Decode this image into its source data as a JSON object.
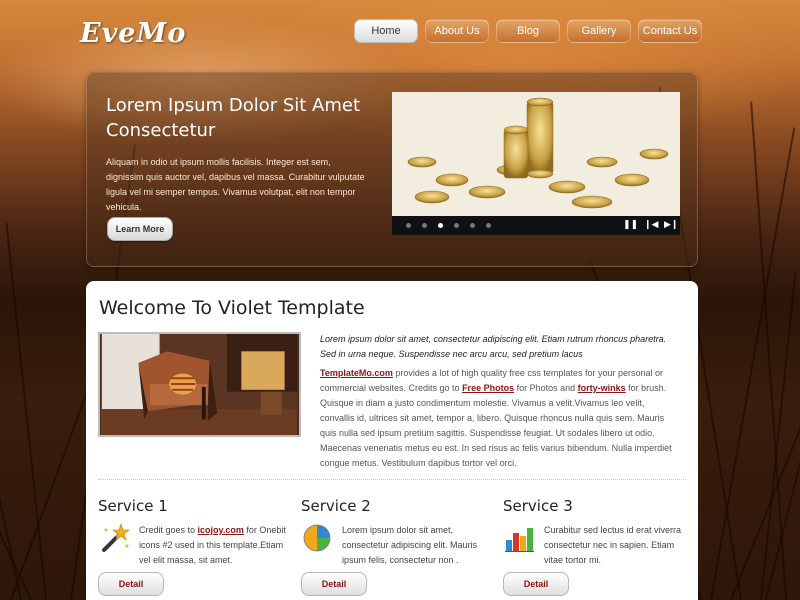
{
  "logo": "EveMo",
  "nav": [
    {
      "label": "Home",
      "active": true
    },
    {
      "label": "About Us",
      "active": false
    },
    {
      "label": "Blog",
      "active": false
    },
    {
      "label": "Gallery",
      "active": false
    },
    {
      "label": "Contact Us",
      "active": false
    }
  ],
  "banner": {
    "title": "Lorem Ipsum Dolor Sit Amet Consectetur",
    "text": "Aliquam in odio ut ipsum mollis facilisis. Integer est sem, dignissim quis auctor vel, dapibus vel massa. Curabitur vulputate ligula vel mi semper tempus. Vivamus volutpat, elit non tempor vehicula.",
    "button": "Learn More",
    "slider": {
      "dots": 6,
      "active_dot": 3,
      "controls": [
        "pause",
        "previous",
        "next"
      ]
    }
  },
  "welcome": {
    "title": "Welcome To Violet Template",
    "intro": "Lorem ipsum dolor sit amet, consectetur adipiscing elit. Etiam rutrum rhoncus pharetra. Sed in urna neque. Suspendisse nec arcu arcu, sed pretium lacus",
    "link1": "TemplateMo.com",
    "text1": " provides a lot of high quality free css templates for your personal or commercial websites. Credits go to ",
    "link2": "Free Photos",
    "text2": " for Photos and ",
    "link3": "forty-winks",
    "text3": " for brush. Quisque in diam a justo condimentum molestie. Vivamus a velit.Vivamus leo velit, convallis id, ultrices sit amet, tempor a, libero. Quisque rhoncus nulla quis sem. Mauris quis nulla sed ipsum pretium sagittis. Suspendisse feugiat. Ut sodales libero ut odio. Maecenas venenatis metus eu est. In sed risus ac felis varius bibendum. Nulla imperdiet congue metus. Vestibulum dapibus tortor vel orci."
  },
  "services": [
    {
      "title": "Service 1",
      "icon": "magic-wand-icon",
      "pre": "Credit goes to ",
      "link": "icojoy.com",
      "post": " for Onebit icons #2 used in this template.Etiam vel elit massa, sit amet.",
      "button": "Detail"
    },
    {
      "title": "Service 2",
      "icon": "pie-chart-icon",
      "pre": "Lorem ipsum dolor sit amet, consectetur adipiscing elit. Mauris ipsum felis, consectetur non .",
      "link": "",
      "post": "",
      "button": "Detail"
    },
    {
      "title": "Service 3",
      "icon": "bar-chart-icon",
      "pre": "Curabitur sed lectus id erat viverra consectetur nec in sapien. Etiam vitae tortor mi.",
      "link": "",
      "post": "",
      "button": "Detail"
    }
  ]
}
